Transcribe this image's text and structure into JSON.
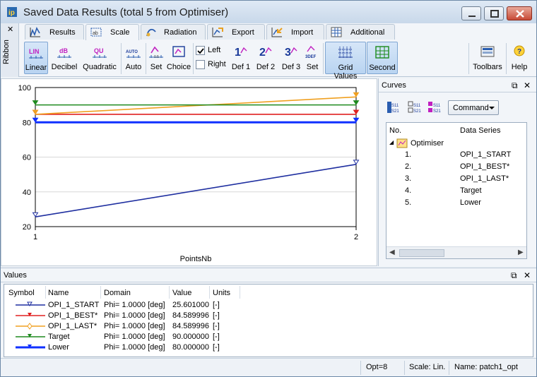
{
  "window": {
    "title": "Saved Data Results (total 5 from Optimiser)"
  },
  "ribbon": {
    "label": "Ribbon",
    "tabs": [
      {
        "label": "Results",
        "icon": "results-icon"
      },
      {
        "label": "Scale",
        "icon": "scale-icon",
        "active": true
      },
      {
        "label": "Radiation",
        "icon": "radiation-icon"
      },
      {
        "label": "Export",
        "icon": "export-icon"
      },
      {
        "label": "Import",
        "icon": "import-icon"
      },
      {
        "label": "Additional",
        "icon": "additional-icon"
      }
    ],
    "buttons": {
      "linear": "Linear",
      "linear_icon": "LIN",
      "decibel": "Decibel",
      "decibel_icon": "dB",
      "quadratic": "Quadratic",
      "quadratic_icon": "QU",
      "auto": "Auto",
      "auto_icon": "AUTO",
      "set": "Set",
      "choice": "Choice",
      "left": "Left",
      "right": "Right",
      "def1": "Def 1",
      "def2": "Def 2",
      "def3": "Def 3",
      "set2": "Set",
      "def1_icon": "1",
      "def2_icon": "2",
      "def3_icon": "3",
      "set_def_icon": "3DEF",
      "grid_values": "Grid Values",
      "second": "Second",
      "toolbars": "Toolbars",
      "help": "Help"
    },
    "checkbox_left_checked": true,
    "checkbox_right_checked": false
  },
  "chart_data": {
    "type": "line",
    "xlabel": "PointsNb",
    "ylabel": "",
    "xlim": [
      1,
      2
    ],
    "ylim": [
      20,
      100
    ],
    "x_ticks": [
      "1",
      "2"
    ],
    "y_ticks": [
      "20",
      "40",
      "60",
      "80",
      "100"
    ],
    "grid": true,
    "series": [
      {
        "name": "OPI_1_START",
        "color": "#1f2fa0",
        "x": [
          1,
          2
        ],
        "y": [
          25.6,
          55.8
        ]
      },
      {
        "name": "OPI_1_BEST*",
        "color": "#e02020",
        "x": [
          1,
          2
        ],
        "y": [
          84.59,
          84.59
        ]
      },
      {
        "name": "OPI_1_LAST*",
        "color": "#f0a020",
        "x": [
          1,
          2
        ],
        "y": [
          84.59,
          94.6
        ]
      },
      {
        "name": "Target",
        "color": "#1f8a1f",
        "x": [
          1,
          2
        ],
        "y": [
          90.0,
          90.0
        ]
      },
      {
        "name": "Lower",
        "color": "#1030ff",
        "x": [
          1,
          2
        ],
        "y": [
          80.0,
          80.0
        ]
      }
    ]
  },
  "curves_panel": {
    "title": "Curves",
    "command_label": "Command",
    "col_no": "No.",
    "col_series": "Data Series",
    "root_label": "Optimiser",
    "items": [
      {
        "no": "1.",
        "name": "OPI_1_START"
      },
      {
        "no": "2.",
        "name": "OPI_1_BEST*"
      },
      {
        "no": "3.",
        "name": "OPI_1_LAST*"
      },
      {
        "no": "4.",
        "name": "Target"
      },
      {
        "no": "5.",
        "name": "Lower"
      }
    ]
  },
  "values_panel": {
    "title": "Values",
    "headers": {
      "symbol": "Symbol",
      "name": "Name",
      "domain": "Domain",
      "value": "Value",
      "units": "Units"
    },
    "rows": [
      {
        "name": "OPI_1_START",
        "domain": "Phi=  1.0000 [deg]",
        "value": "25.601000",
        "units": "[-]",
        "color": "#1f2fa0"
      },
      {
        "name": "OPI_1_BEST*",
        "domain": "Phi=  1.0000 [deg]",
        "value": "84.589996",
        "units": "[-]",
        "color": "#e02020"
      },
      {
        "name": "OPI_1_LAST*",
        "domain": "Phi=  1.0000 [deg]",
        "value": "84.589996",
        "units": "[-]",
        "color": "#f0a020"
      },
      {
        "name": "Target",
        "domain": "Phi=  1.0000 [deg]",
        "value": "90.000000",
        "units": "[-]",
        "color": "#1f8a1f"
      },
      {
        "name": "Lower",
        "domain": "Phi=  1.0000 [deg]",
        "value": "80.000000",
        "units": "[-]",
        "color": "#1030ff"
      }
    ]
  },
  "status": {
    "opt": "Opt=8",
    "scale": "Scale: Lin.",
    "name": "Name: patch1_opt"
  }
}
